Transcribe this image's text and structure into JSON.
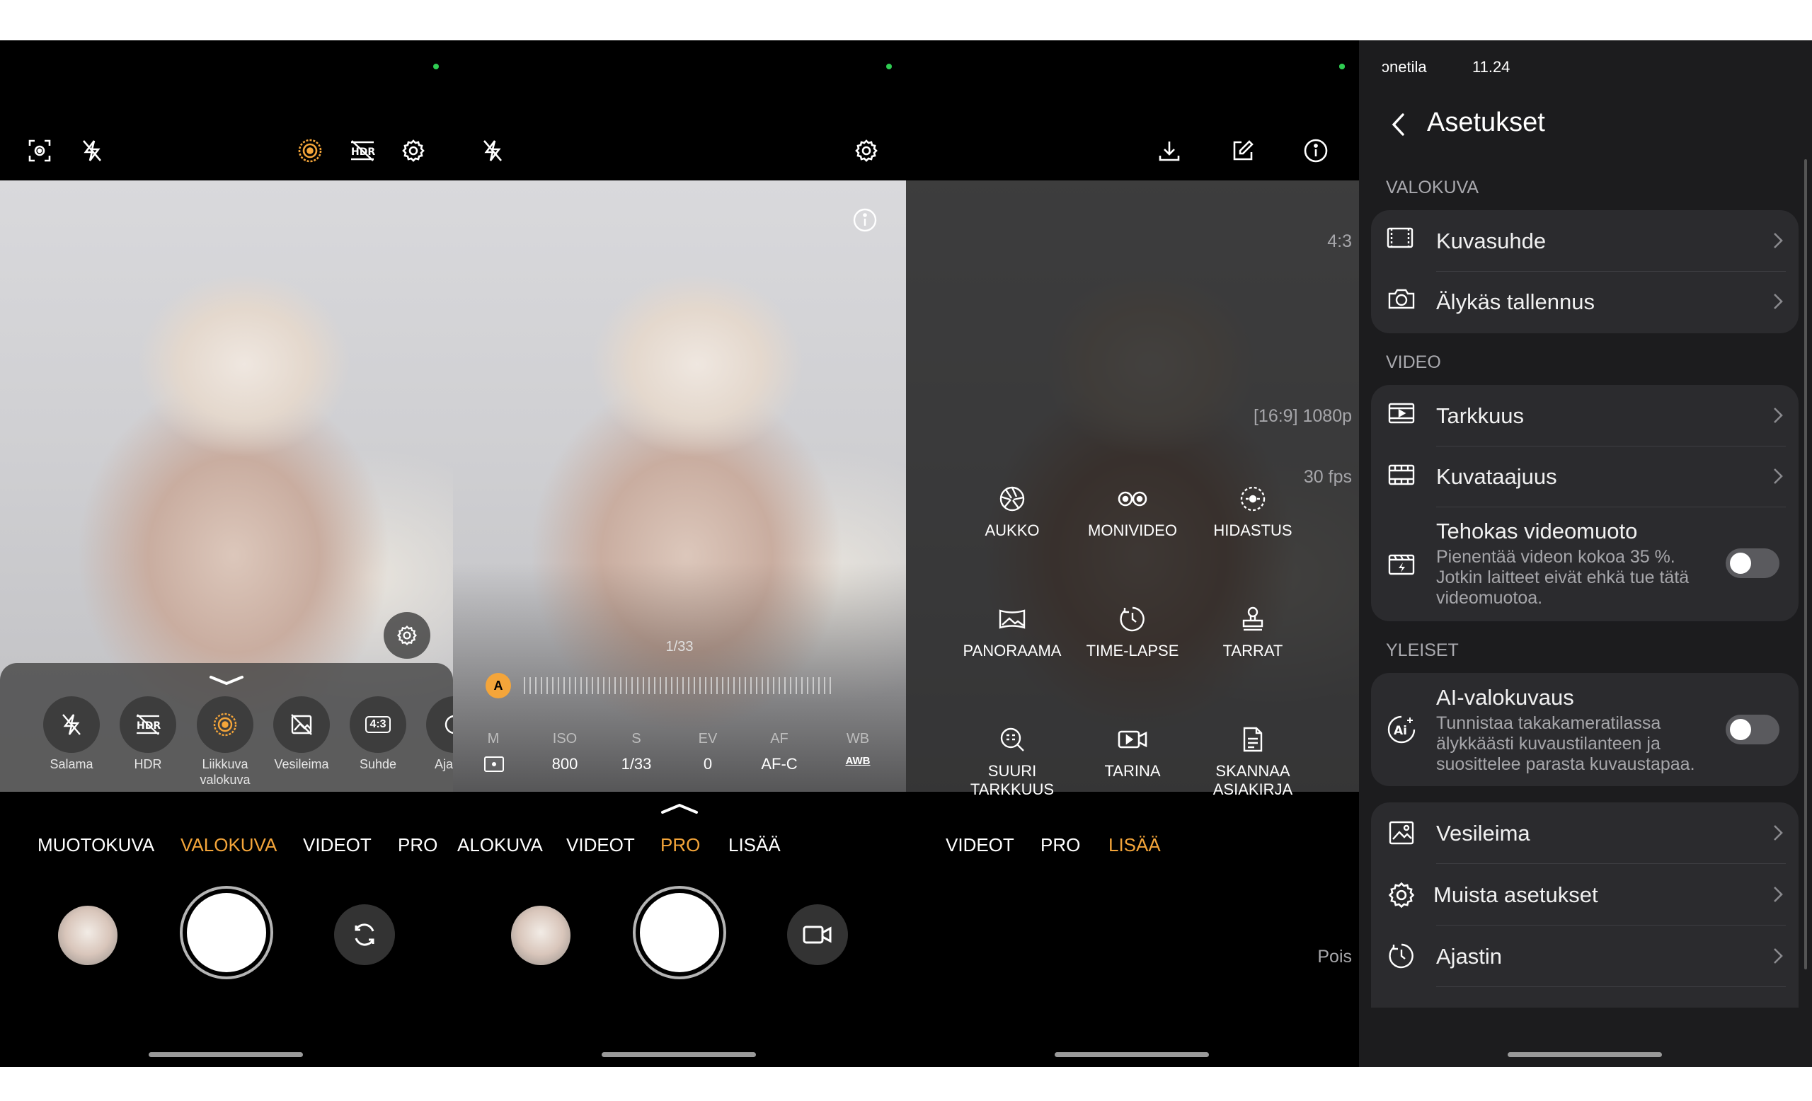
{
  "screens": {
    "photo": {
      "tools": [
        {
          "label": "Salama",
          "icon": "flash-off-icon"
        },
        {
          "label": "HDR",
          "icon": "hdr-off-icon"
        },
        {
          "label": "Liikkuva\nvalokuva",
          "icon": "motion-photo-icon"
        },
        {
          "label": "Vesileima",
          "icon": "watermark-off-icon"
        },
        {
          "label": "Suhde",
          "icon": "ratio-icon",
          "badge": "4:3"
        },
        {
          "label": "Aja",
          "icon": "timer-icon"
        }
      ],
      "modes": [
        "MUOTOKUVA",
        "VALOKUVA",
        "VIDEOT",
        "PRO"
      ],
      "active_mode": "VALOKUVA"
    },
    "pro": {
      "shutter_readout": "1/33",
      "auto_badge": "A",
      "params": [
        {
          "label": "M",
          "value": ""
        },
        {
          "label": "ISO",
          "value": "800"
        },
        {
          "label": "S",
          "value": "1/33"
        },
        {
          "label": "EV",
          "value": "0"
        },
        {
          "label": "AF",
          "value": "AF-C"
        },
        {
          "label": "WB",
          "value": "AWB"
        }
      ],
      "modes": [
        "ALOKUVA",
        "VIDEOT",
        "PRO",
        "LISÄÄ"
      ],
      "active_mode": "PRO"
    },
    "more": {
      "items": [
        {
          "label": "AUKKO",
          "icon": "aperture-icon"
        },
        {
          "label": "MONIVIDEO",
          "icon": "multivideo-icon"
        },
        {
          "label": "HIDASTUS",
          "icon": "slowmotion-icon"
        },
        {
          "label": "PANORAAMA",
          "icon": "panorama-icon"
        },
        {
          "label": "TIME-LAPSE",
          "icon": "timelapse-icon"
        },
        {
          "label": "TARRAT",
          "icon": "stamp-icon"
        },
        {
          "label": "SUURI\nTARKKUUS",
          "icon": "high-resolution-icon"
        },
        {
          "label": "TARINA",
          "icon": "story-icon"
        },
        {
          "label": "SKANNAA\nASIAKIRJA",
          "icon": "document-scan-icon"
        }
      ],
      "modes": [
        "VIDEOT",
        "PRO",
        "LISÄÄ"
      ],
      "active_mode": "LISÄÄ"
    }
  },
  "settings": {
    "status_left": "ɔnetila",
    "status_time": "11.24",
    "title": "Asetukset",
    "sections": {
      "photo": "VALOKUVA",
      "video": "VIDEO",
      "general": "YLEISET"
    },
    "rows": {
      "aspect": {
        "title": "Kuvasuhde",
        "value": "4:3"
      },
      "smart_save": {
        "title": "Älykäs tallennus"
      },
      "resolution": {
        "title": "Tarkkuus",
        "value": "[16:9] 1080p"
      },
      "frame_rate": {
        "title": "Kuvataajuus",
        "value": "30 fps"
      },
      "efficient_video": {
        "title": "Tehokas videomuoto",
        "desc": "Pienentää videon kokoa 35 %. Jotkin laitteet eivät ehkä tue tätä videomuotoa.",
        "enabled": false
      },
      "ai_photo": {
        "title": "AI-valokuvaus",
        "desc": "Tunnistaa takakameratilassa älykkäästi kuvaustilanteen ja suosittelee parasta kuvaustapaa.",
        "enabled": false
      },
      "watermark": {
        "title": "Vesileima"
      },
      "more_settings": {
        "title": "Muista asetukset"
      },
      "timer": {
        "title": "Ajastin",
        "value": "Pois"
      }
    }
  },
  "colors": {
    "accent": "#f4a53a",
    "status_dot": "#2fcc52",
    "settings_bg": "#1c1c1e",
    "card_bg": "#2b2b2e"
  }
}
